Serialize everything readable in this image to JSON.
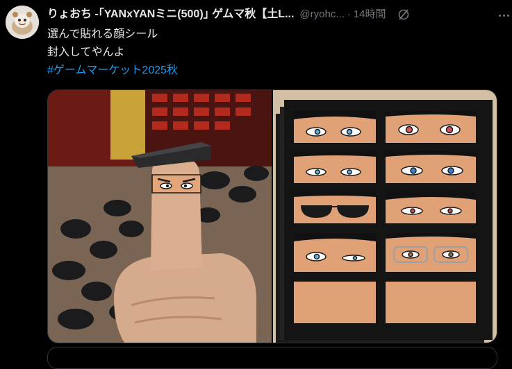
{
  "tweet": {
    "display_name": "りょおち -｢YANxYANミニ(500)｣ ゲムマ秋【土L...",
    "handle": "@ryohc...",
    "separator": "·",
    "time": "14時間",
    "lines": [
      "選んで貼れる顔シール",
      "封入してやんよ"
    ],
    "hashtag": "#ゲームマーケット2025秋",
    "icons": {
      "grok": "grok-icon",
      "more": "more-icon"
    }
  },
  "media": {
    "left_photo": "thumb-with-face-sticker-photo",
    "right_photo": "face-sticker-sheet-photo"
  },
  "colors": {
    "background": "#000000",
    "text": "#e7e9ea",
    "muted": "#71767b",
    "link": "#1d9bf0",
    "border": "#2f3336"
  }
}
